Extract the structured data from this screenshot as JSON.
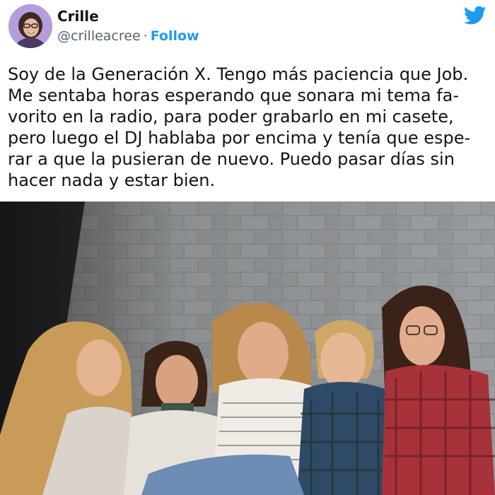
{
  "tweet": {
    "author": {
      "display_name": "Crille",
      "handle": "@crilleacree",
      "separator": "·",
      "follow_label": "Follow"
    },
    "platform_icon": "twitter-bird-icon",
    "text": "Soy de la Generación X. Tengo más paciencia que Job.\nMe sentaba horas esperando que sonara mi tema fa-\nvorito en la radio, para poder grabarlo en mi casete,\npero luego el DJ hablaba por encima y tenía que espe-\nrar a que la pusieran de nuevo. Puedo pasar días sin\nhacer nada y estar bien."
  },
  "colors": {
    "accent": "#1d9bf0",
    "text": "#0f1419",
    "secondary_text": "#536471"
  }
}
